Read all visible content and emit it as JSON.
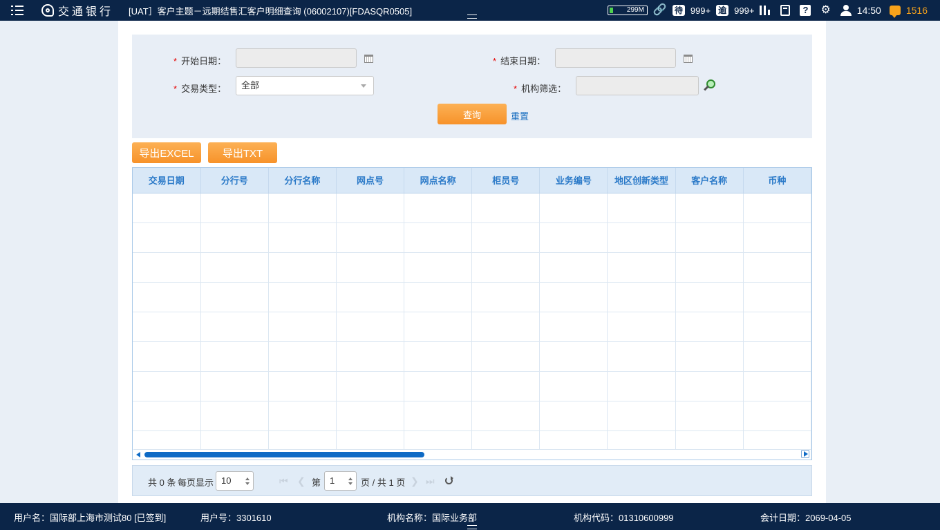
{
  "header": {
    "logo_text": "交通银行",
    "window_title": "[UAT］客户主题－远期结售汇客户明细查询  (06002107)[FDASQR0505]",
    "battery": "299M",
    "todo_label": "待",
    "todo_count": "999+",
    "overdue_label": "逾",
    "overdue_count": "999+",
    "help_label": "?",
    "time": "14:50",
    "message_count": "1516",
    "accent_color": "#f7a21b"
  },
  "filter": {
    "start_date_label": "开始日期：",
    "start_date_value": "",
    "end_date_label": "结束日期：",
    "end_date_value": "",
    "trade_type_label": "交易类型：",
    "trade_type_value": "全部",
    "org_filter_label": "机构筛选：",
    "org_filter_value": "",
    "required_mark": "*",
    "query_button": "查询",
    "reset_link": "重置"
  },
  "toolbar": {
    "export_excel": "导出EXCEL",
    "export_txt": "导出TXT"
  },
  "grid": {
    "columns": [
      "交易日期",
      "分行号",
      "分行名称",
      "网点号",
      "网点名称",
      "柜员号",
      "业务编号",
      "地区创新类型",
      "客户名称",
      "币种"
    ],
    "rows": []
  },
  "pager": {
    "total": "共 0 条",
    "page_size_label": "每页显示",
    "page_size": "10",
    "page_prefix": "第",
    "page": "1",
    "page_suffix": "页 / 共 1 页"
  },
  "status": {
    "username": "用户名：国际部上海市测试80 [已签到]",
    "userid": "用户号：3301610",
    "org_name": "机构名称：国际业务部",
    "org_code": "机构代码：01310600999",
    "acct_date": "会计日期：2069-04-05"
  }
}
